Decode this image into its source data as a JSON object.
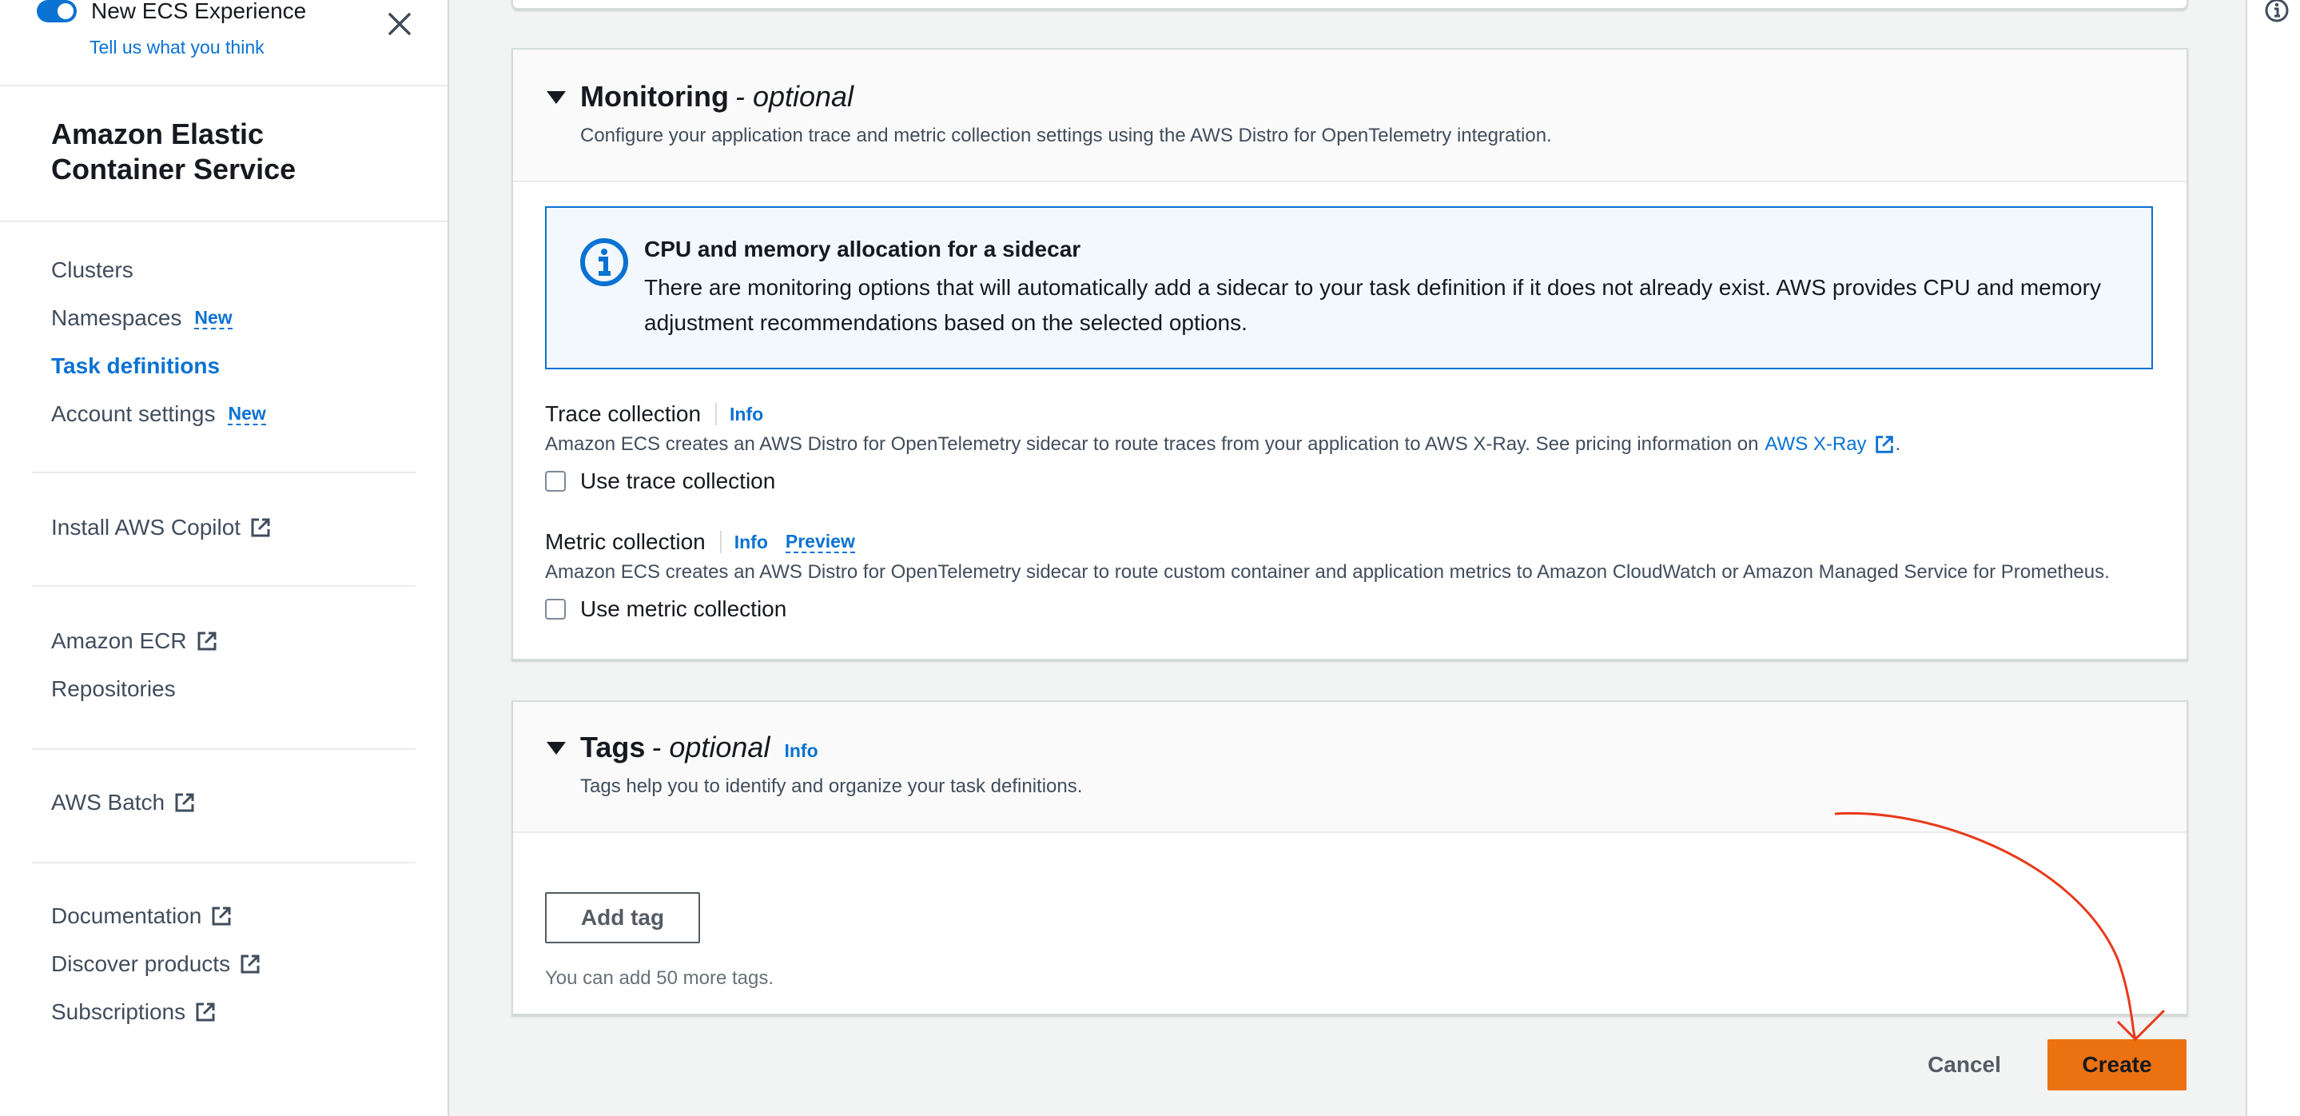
{
  "sidebar": {
    "toggle_label": "New ECS Experience",
    "feedback_link": "Tell us what you think",
    "service_title": "Amazon Elastic\nContainer Service",
    "nav": {
      "clusters": "Clusters",
      "namespaces": "Namespaces",
      "namespaces_badge": "New",
      "task_definitions": "Task definitions",
      "account_settings": "Account settings",
      "account_settings_badge": "New"
    },
    "links": {
      "install_copilot": "Install AWS Copilot",
      "amazon_ecr": "Amazon ECR",
      "repositories": "Repositories",
      "aws_batch": "AWS Batch",
      "documentation": "Documentation",
      "discover_products": "Discover products",
      "subscriptions": "Subscriptions"
    }
  },
  "monitoring": {
    "title": "Monitoring",
    "optional": "- optional",
    "description": "Configure your application trace and metric collection settings using the AWS Distro for OpenTelemetry integration.",
    "alert": {
      "title": "CPU and memory allocation for a sidecar",
      "body": "There are monitoring options that will automatically add a sidecar to your task definition if it does not already exist. AWS provides CPU and memory adjustment recommendations based on the selected options."
    },
    "trace": {
      "label": "Trace collection",
      "info": "Info",
      "description": "Amazon ECS creates an AWS Distro for OpenTelemetry sidecar to route traces from your application to AWS X-Ray. See pricing information on",
      "xray_link": "AWS X-Ray",
      "trailing": ".",
      "checkbox_label": "Use trace collection",
      "checked": false
    },
    "metric": {
      "label": "Metric collection",
      "info": "Info",
      "preview": "Preview",
      "description": "Amazon ECS creates an AWS Distro for OpenTelemetry sidecar to route custom container and application metrics to Amazon CloudWatch or Amazon Managed Service for Prometheus.",
      "checkbox_label": "Use metric collection",
      "checked": false
    }
  },
  "tags": {
    "title": "Tags",
    "optional": "- optional",
    "info": "Info",
    "description": "Tags help you to identify and organize your task definitions.",
    "add_button": "Add tag",
    "hint": "You can add 50 more tags."
  },
  "footer": {
    "cancel": "Cancel",
    "create": "Create"
  },
  "colors": {
    "accent": "#0972d3",
    "primary_button": "#ec7211",
    "annotation": "#e8391a"
  }
}
